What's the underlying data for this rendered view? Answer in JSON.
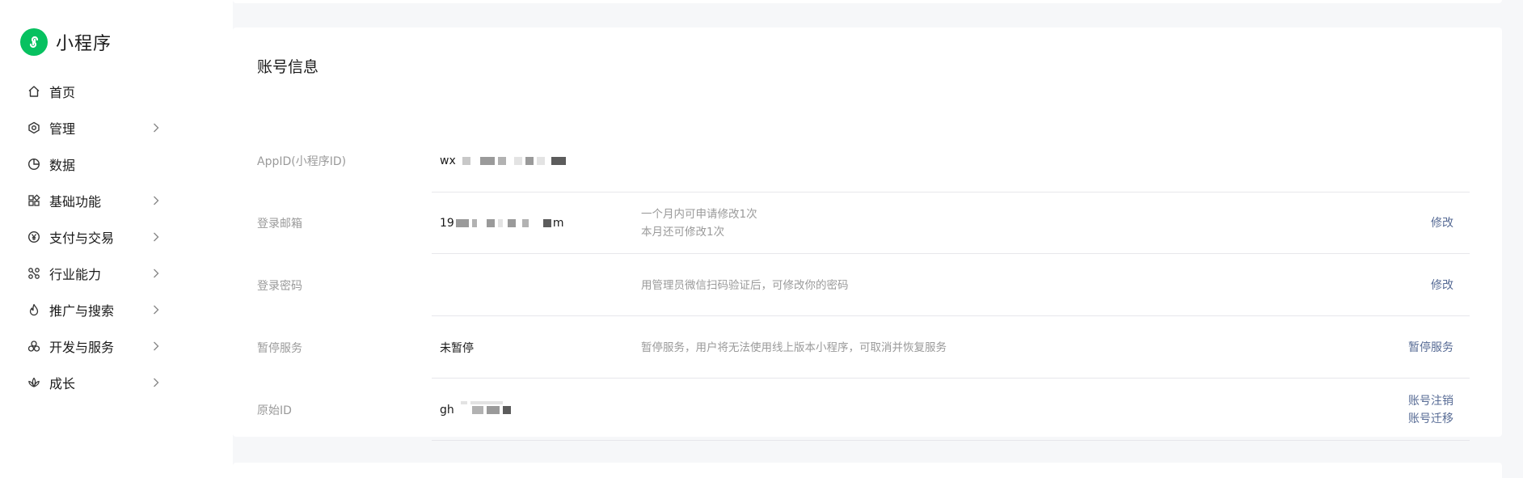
{
  "app": {
    "name": "小程序",
    "brand_color": "#07c160"
  },
  "sidebar": {
    "items": [
      {
        "label": "首页",
        "icon": "home-icon",
        "has_arrow": false
      },
      {
        "label": "管理",
        "icon": "hexagon-settings-icon",
        "has_arrow": true
      },
      {
        "label": "数据",
        "icon": "pie-chart-icon",
        "has_arrow": false
      },
      {
        "label": "基础功能",
        "icon": "grid-apps-icon",
        "has_arrow": true
      },
      {
        "label": "支付与交易",
        "icon": "yen-coin-icon",
        "has_arrow": true
      },
      {
        "label": "行业能力",
        "icon": "network-nodes-icon",
        "has_arrow": true
      },
      {
        "label": "推广与搜索",
        "icon": "flame-icon",
        "has_arrow": true
      },
      {
        "label": "开发与服务",
        "icon": "cluster-circles-icon",
        "has_arrow": true
      },
      {
        "label": "成长",
        "icon": "lotus-icon",
        "has_arrow": true
      }
    ]
  },
  "account": {
    "title": "账号信息",
    "rows": [
      {
        "label": "AppID(小程序ID)",
        "value_prefix": "wx",
        "value_suffix": "",
        "desc": [],
        "actions": []
      },
      {
        "label": "登录邮箱",
        "value_prefix": "19",
        "value_suffix": "m",
        "desc": [
          "一个月内可申请修改1次",
          "本月还可修改1次"
        ],
        "actions": [
          "修改"
        ]
      },
      {
        "label": "登录密码",
        "value_prefix": "",
        "value_suffix": "",
        "desc": [
          "用管理员微信扫码验证后，可修改你的密码"
        ],
        "actions": [
          "修改"
        ]
      },
      {
        "label": "暂停服务",
        "value_prefix": "未暂停",
        "value_suffix": "",
        "desc": [
          "暂停服务，用户将无法使用线上版本小程序，可取消并恢复服务"
        ],
        "actions": [
          "暂停服务"
        ]
      },
      {
        "label": "原始ID",
        "value_prefix": "gh",
        "value_suffix": "",
        "desc": [],
        "actions": [
          "账号注销",
          "账号迁移"
        ]
      }
    ]
  },
  "colors": {
    "link": "#576b95",
    "muted": "#9a9a9a",
    "text": "#1a1a1a",
    "divider": "#e7e7eb"
  }
}
